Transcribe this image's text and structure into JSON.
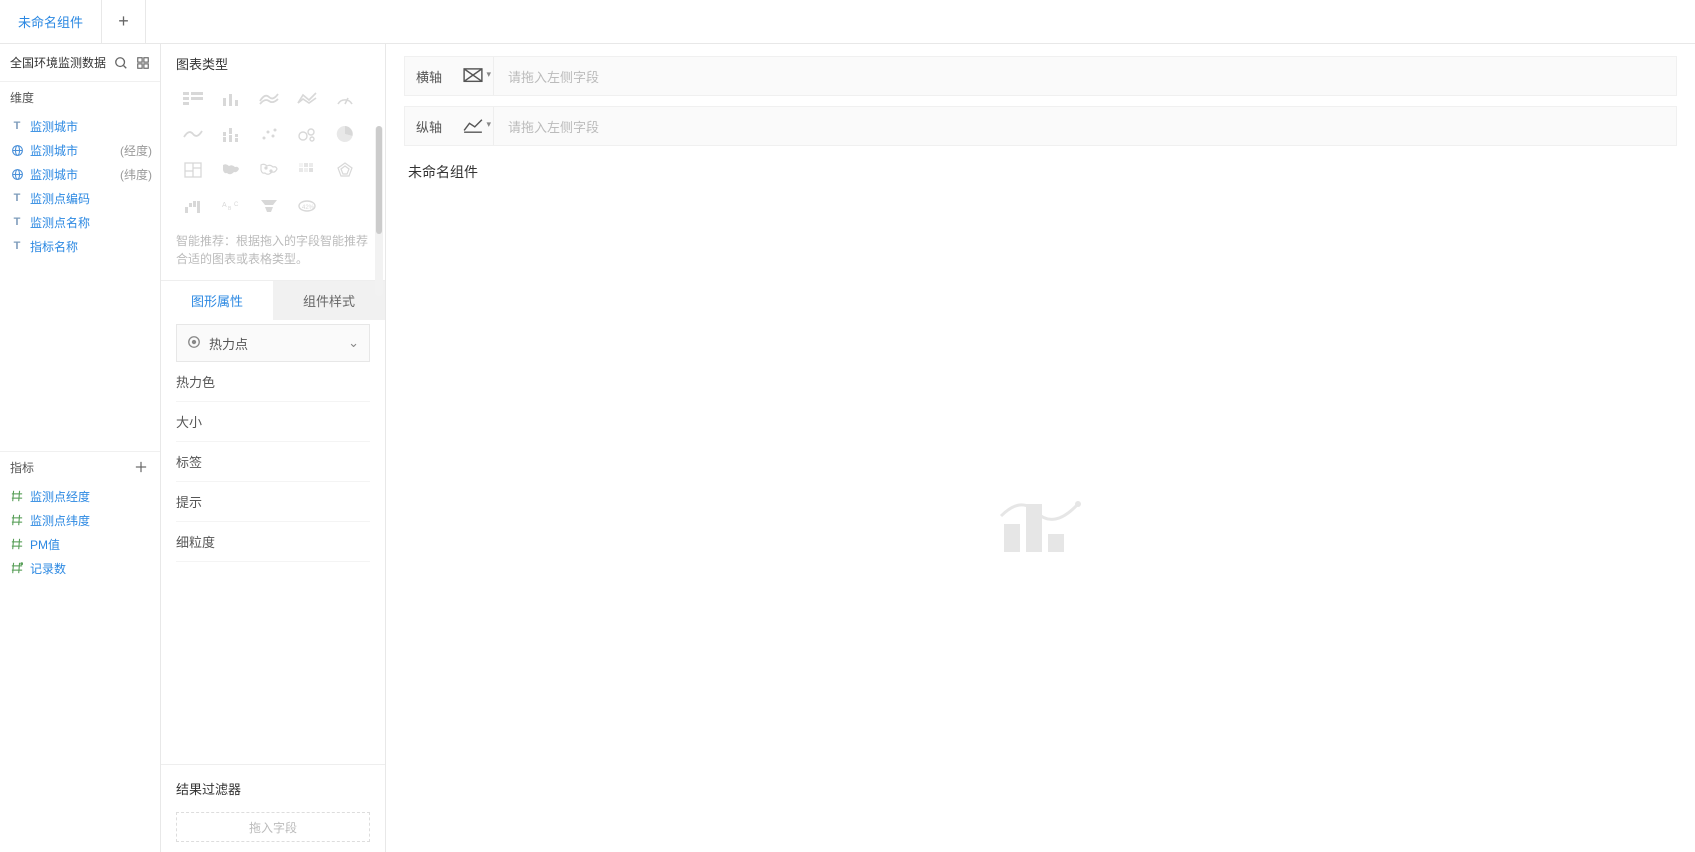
{
  "tabs": {
    "active": "未命名组件"
  },
  "datasource": {
    "name": "全国环境监测数据"
  },
  "dimensions": {
    "header": "维度",
    "items": [
      {
        "icon": "T",
        "name": "监测城市",
        "suffix": ""
      },
      {
        "icon": "globe",
        "name": "监测城市",
        "suffix": "(经度)"
      },
      {
        "icon": "globe",
        "name": "监测城市",
        "suffix": "(纬度)"
      },
      {
        "icon": "T",
        "name": "监测点编码",
        "suffix": ""
      },
      {
        "icon": "T",
        "name": "监测点名称",
        "suffix": ""
      },
      {
        "icon": "T",
        "name": "指标名称",
        "suffix": ""
      }
    ]
  },
  "measures": {
    "header": "指标",
    "items": [
      {
        "icon": "hash",
        "name": "监测点经度"
      },
      {
        "icon": "hash",
        "name": "监测点纬度"
      },
      {
        "icon": "hash",
        "name": "PM值"
      },
      {
        "icon": "hashstar",
        "name": "记录数"
      }
    ]
  },
  "chart_type": {
    "header": "图表类型",
    "hint": "智能推荐：根据拖入的字段智能推荐合适的图表或表格类型。"
  },
  "prop_tabs": {
    "graphic": "图形属性",
    "style": "组件样式"
  },
  "graphic_props": {
    "dropdown": "热力点",
    "items": [
      "热力色",
      "大小",
      "标签",
      "提示",
      "细粒度"
    ]
  },
  "filter": {
    "header": "结果过滤器",
    "placeholder": "拖入字段"
  },
  "axes": {
    "x_label": "横轴",
    "y_label": "纵轴",
    "placeholder": "请拖入左侧字段"
  },
  "component": {
    "title": "未命名组件"
  }
}
